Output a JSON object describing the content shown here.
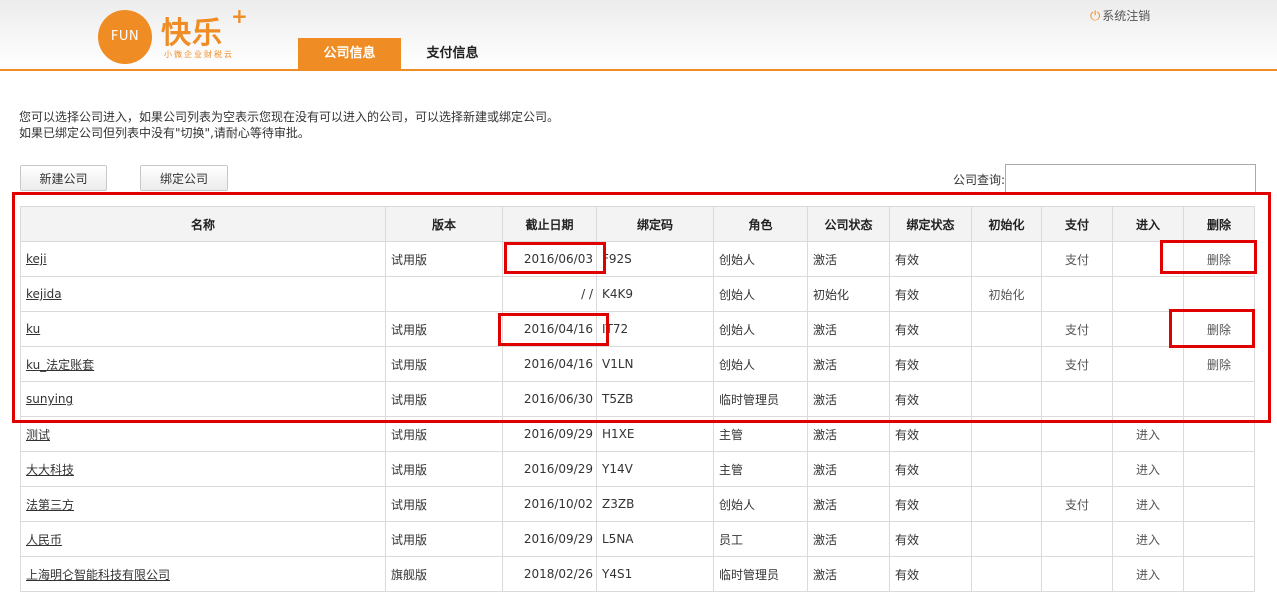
{
  "header": {
    "logo_mark": "FUN",
    "logo_name": "快乐",
    "logo_plus": "+",
    "logo_tagline": "小微企业财税云",
    "logout_label": "系统注销",
    "tabs": [
      {
        "label": "公司信息",
        "active": true
      },
      {
        "label": "支付信息",
        "active": false
      }
    ]
  },
  "notice": {
    "line1": "您可以选择公司进入，如果公司列表为空表示您现在没有可以进入的公司，可以选择新建或绑定公司。",
    "line2": "如果已绑定公司但列表中没有\"切换\",请耐心等待审批。"
  },
  "toolbar": {
    "new_label": "新建公司",
    "bind_label": "绑定公司",
    "search_label": "公司查询:",
    "search_value": ""
  },
  "table": {
    "headers": [
      "名称",
      "版本",
      "截止日期",
      "绑定码",
      "角色",
      "公司状态",
      "绑定状态",
      "初始化",
      "支付",
      "进入",
      "删除"
    ],
    "rows": [
      {
        "name": "keji",
        "version": "试用版",
        "date": "2016/06/03",
        "code": "F92S",
        "role": "创始人",
        "status": "激活",
        "bind": "有效",
        "init": "",
        "pay": "支付",
        "enter": "",
        "delete": "删除"
      },
      {
        "name": "kejida",
        "version": "",
        "date": "/ /",
        "code": "K4K9",
        "role": "创始人",
        "status": "初始化",
        "bind": "有效",
        "init": "初始化",
        "pay": "",
        "enter": "",
        "delete": ""
      },
      {
        "name": "ku",
        "version": "试用版",
        "date": "2016/04/16",
        "code": "IT72",
        "role": "创始人",
        "status": "激活",
        "bind": "有效",
        "init": "",
        "pay": "支付",
        "enter": "",
        "delete": "删除"
      },
      {
        "name": "ku_法定账套",
        "version": "试用版",
        "date": "2016/04/16",
        "code": "V1LN",
        "role": "创始人",
        "status": "激活",
        "bind": "有效",
        "init": "",
        "pay": "支付",
        "enter": "",
        "delete": "删除"
      },
      {
        "name": "sunying",
        "version": "试用版",
        "date": "2016/06/30",
        "code": "T5ZB",
        "role": "临时管理员",
        "status": "激活",
        "bind": "有效",
        "init": "",
        "pay": "",
        "enter": "",
        "delete": ""
      },
      {
        "name": "测试",
        "version": "试用版",
        "date": "2016/09/29",
        "code": "H1XE",
        "role": "主管",
        "status": "激活",
        "bind": "有效",
        "init": "",
        "pay": "",
        "enter": "进入",
        "delete": ""
      },
      {
        "name": "大大科技",
        "version": "试用版",
        "date": "2016/09/29",
        "code": "Y14V",
        "role": "主管",
        "status": "激活",
        "bind": "有效",
        "init": "",
        "pay": "",
        "enter": "进入",
        "delete": ""
      },
      {
        "name": "法第三方",
        "version": "试用版",
        "date": "2016/10/02",
        "code": "Z3ZB",
        "role": "创始人",
        "status": "激活",
        "bind": "有效",
        "init": "",
        "pay": "支付",
        "enter": "进入",
        "delete": ""
      },
      {
        "name": "人民币",
        "version": "试用版",
        "date": "2016/09/29",
        "code": "L5NA",
        "role": "员工",
        "status": "激活",
        "bind": "有效",
        "init": "",
        "pay": "",
        "enter": "进入",
        "delete": ""
      },
      {
        "name": "上海明仑智能科技有限公司",
        "version": "旗舰版",
        "date": "2018/02/26",
        "code": "Y4S1",
        "role": "临时管理员",
        "status": "激活",
        "bind": "有效",
        "init": "",
        "pay": "",
        "enter": "进入",
        "delete": ""
      }
    ]
  },
  "colors": {
    "accent": "#f08c24",
    "highlight": "#e00000"
  }
}
